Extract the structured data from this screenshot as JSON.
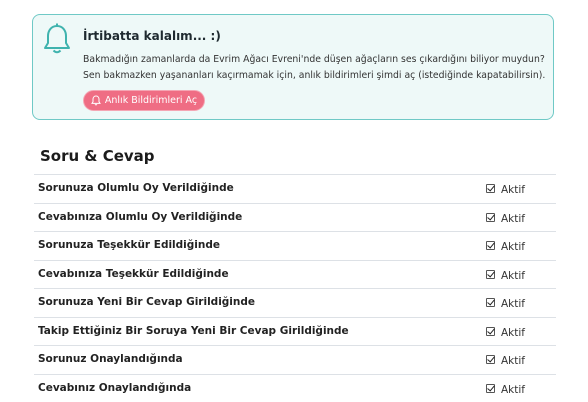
{
  "banner": {
    "title": "İrtibatta kalalım... :)",
    "text": "Bakmadığın zamanlarda da Evrim Ağacı Evreni'nde düşen ağaçların ses çıkardığını biliyor muydun? Sen bakmazken yaşananları kaçırmamak için, anlık bildirimleri şimdi aç (istediğinde kapatabilirsin).",
    "button_label": "Anlık Bildirimleri Aç"
  },
  "section": {
    "title": "Soru & Cevap",
    "rows": [
      {
        "label": "Sorunuza Olumlu Oy Verildiğinde",
        "status": "Aktif"
      },
      {
        "label": "Cevabınıza Olumlu Oy Verildiğinde",
        "status": "Aktif"
      },
      {
        "label": "Sorunuza Teşekkür Edildiğinde",
        "status": "Aktif"
      },
      {
        "label": "Cevabınıza Teşekkür Edildiğinde",
        "status": "Aktif"
      },
      {
        "label": "Sorunuza Yeni Bir Cevap Girildiğinde",
        "status": "Aktif"
      },
      {
        "label": "Takip Ettiğiniz Bir Soruya Yeni Bir Cevap Girildiğinde",
        "status": "Aktif"
      },
      {
        "label": "Sorunuz Onaylandığında",
        "status": "Aktif"
      },
      {
        "label": "Cevabınız Onaylandığında",
        "status": "Aktif"
      }
    ]
  },
  "colors": {
    "accent": "#6fc9c6",
    "button": "#ef6d84"
  }
}
